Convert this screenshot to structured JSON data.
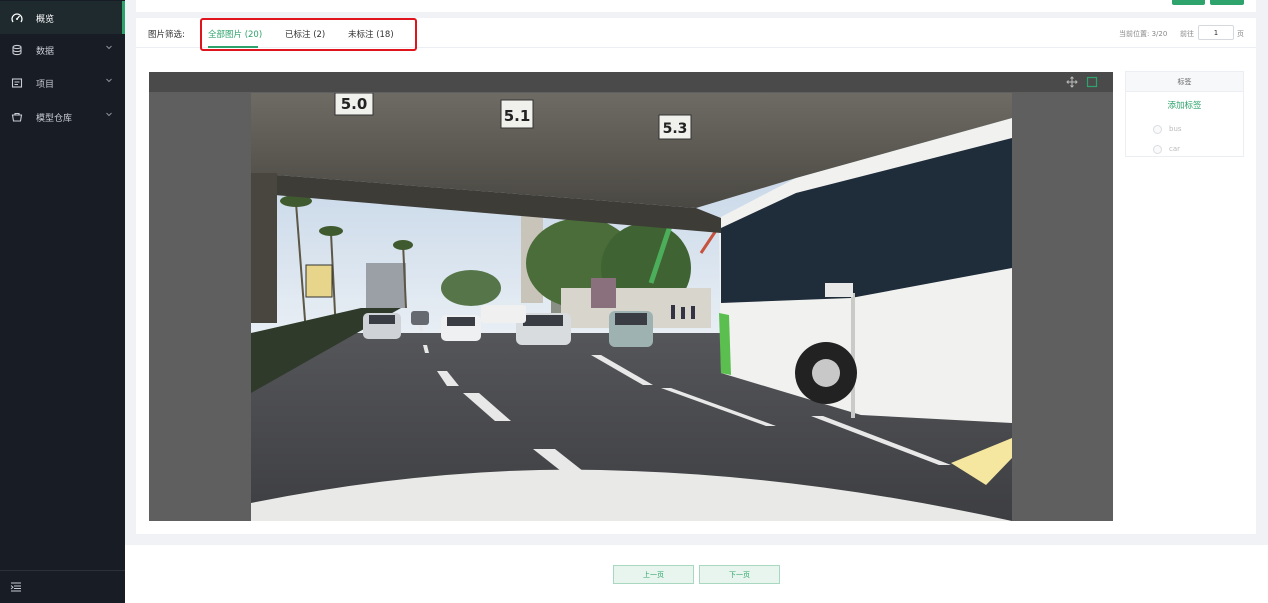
{
  "sidebar": {
    "items": [
      {
        "label": "概览",
        "icon": "dashboard-icon",
        "active": true
      },
      {
        "label": "数据",
        "icon": "database-icon",
        "has_children": true
      },
      {
        "label": "项目",
        "icon": "project-icon",
        "has_children": true
      },
      {
        "label": "模型仓库",
        "icon": "model-repo-icon",
        "has_children": true
      }
    ],
    "collapse_icon": "menu-collapse-icon"
  },
  "filter": {
    "label": "图片筛选:",
    "tabs": [
      {
        "label": "全部图片 (20)",
        "active": true
      },
      {
        "label": "已标注 (2)"
      },
      {
        "label": "未标注 (18)"
      }
    ]
  },
  "pager": {
    "current_position": "当前位置: 3/20",
    "goto_label": "前往",
    "goto_value": "1",
    "page_suffix": "页",
    "prev_label": "上一页",
    "next_label": "下一页"
  },
  "viewer": {
    "tools": [
      "move-icon",
      "rectangle-select-icon"
    ],
    "image_sign_texts": [
      "5.0",
      "5.1",
      "5.3"
    ]
  },
  "labels": {
    "title": "标签",
    "add_label": "添加标签",
    "options": [
      "bus",
      "car"
    ]
  },
  "colors": {
    "accent": "#2ea36b",
    "sidebar_bg": "#181c25",
    "highlight_box": "#e0141c"
  }
}
